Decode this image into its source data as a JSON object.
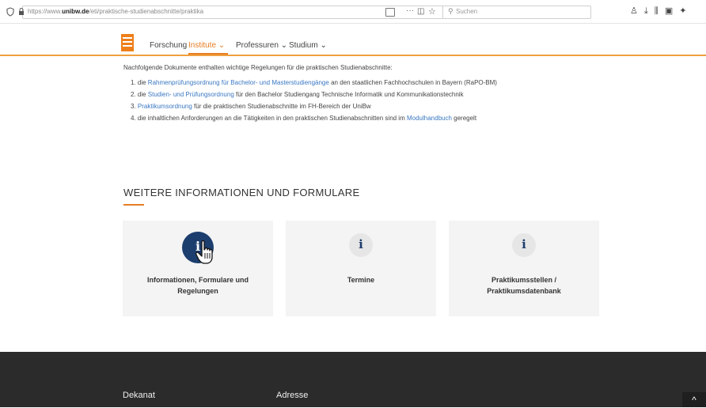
{
  "browser": {
    "url_prefix": "https://www.",
    "url_domain": "unibw.de",
    "url_path": "/eti/praktische-studienabschnitte/praktika",
    "search_placeholder": "Suchen"
  },
  "header": {
    "nav": [
      {
        "label": "Forschung"
      },
      {
        "label": "Institute ⌄"
      },
      {
        "label": "Professuren ⌄"
      },
      {
        "label": "Studium ⌄"
      }
    ]
  },
  "content": {
    "intro": "Nachfolgende Dokumente enthalten wichtige Regelungen für die praktischen Studienabschnitte:",
    "items": [
      {
        "pre": "1. die ",
        "link": "Rahmenprüfungsordnung für Bachelor- und Masterstudiengänge",
        "post": " an den staatlichen Fachhochschulen in Bayern (RaPO-BM)"
      },
      {
        "pre": "2. die ",
        "link": "Studien- und Prüfungsordnung",
        "post": " für den Bachelor Studiengang Technische Informatik und Kommunikationstechnik"
      },
      {
        "pre": "3. ",
        "link": "Praktikumsordnung",
        "post": " für die praktischen Studienabschnitte im FH-Bereich der UniBw"
      },
      {
        "pre": "4. die inhaltlichen Anforderungen an die Tätigkeiten in den praktischen Studienabschnitten sind im ",
        "link": "Modulhandbuch",
        "post": " geregelt"
      }
    ],
    "section_title": "WEITERE INFORMATIONEN UND FORMULARE",
    "cards": [
      {
        "icon": "i",
        "label_line1": "Informationen, Formulare und",
        "label_line2": "Regelungen"
      },
      {
        "icon": "i",
        "label_line1": "Termine",
        "label_line2": ""
      },
      {
        "icon": "i",
        "label_line1": "Praktikumsstellen /",
        "label_line2": "Praktikumsdatenbank"
      }
    ]
  },
  "footer": {
    "col1": "Dekanat",
    "col2": "Adresse",
    "scroll_top": "^"
  }
}
